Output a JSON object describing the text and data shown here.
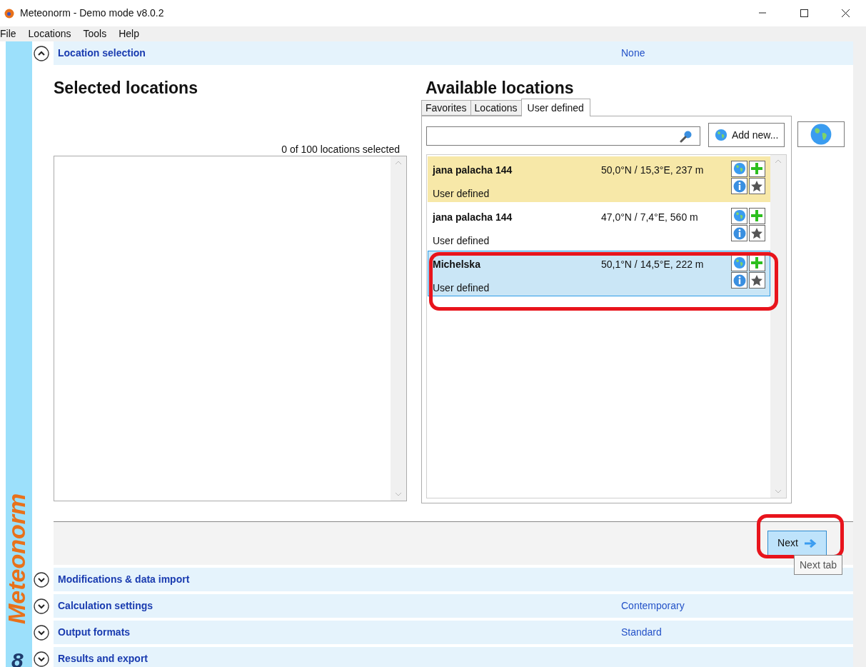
{
  "window": {
    "title": "Meteonorm - Demo mode v8.0.2"
  },
  "menu": [
    "File",
    "Locations",
    "Tools",
    "Help"
  ],
  "brand": {
    "name": "Meteonorm",
    "version": "8"
  },
  "sections": [
    {
      "label": "Location selection",
      "value": "None",
      "expanded": true
    },
    {
      "label": "Modifications & data import",
      "expanded": false
    },
    {
      "label": "Calculation settings",
      "value": "Contemporary",
      "expanded": false
    },
    {
      "label": "Output formats",
      "value": "Standard",
      "expanded": false
    },
    {
      "label": "Results and export",
      "expanded": false
    }
  ],
  "selected_panel": {
    "heading": "Selected locations",
    "count": "0 of 100 locations selected"
  },
  "available_panel": {
    "heading": "Available locations",
    "tabs": [
      {
        "label": "Favorites",
        "selected": false
      },
      {
        "label": "Locations",
        "selected": false
      },
      {
        "label": "User defined",
        "selected": true
      }
    ],
    "add_button": "Add new...",
    "locations": [
      {
        "name": "jana palacha 144",
        "coords": "50,0°N / 15,3°E, 237 m",
        "source": "User defined",
        "highlighted": true,
        "selected": false
      },
      {
        "name": "jana palacha 144",
        "coords": "47,0°N / 7,4°E, 560 m",
        "source": "User defined",
        "highlighted": false,
        "selected": false
      },
      {
        "name": "Michelska",
        "coords": "50,1°N / 14,5°E, 222 m",
        "source": "User defined",
        "highlighted": false,
        "selected": true
      }
    ]
  },
  "next_button": "Next",
  "tooltip": "Next tab"
}
